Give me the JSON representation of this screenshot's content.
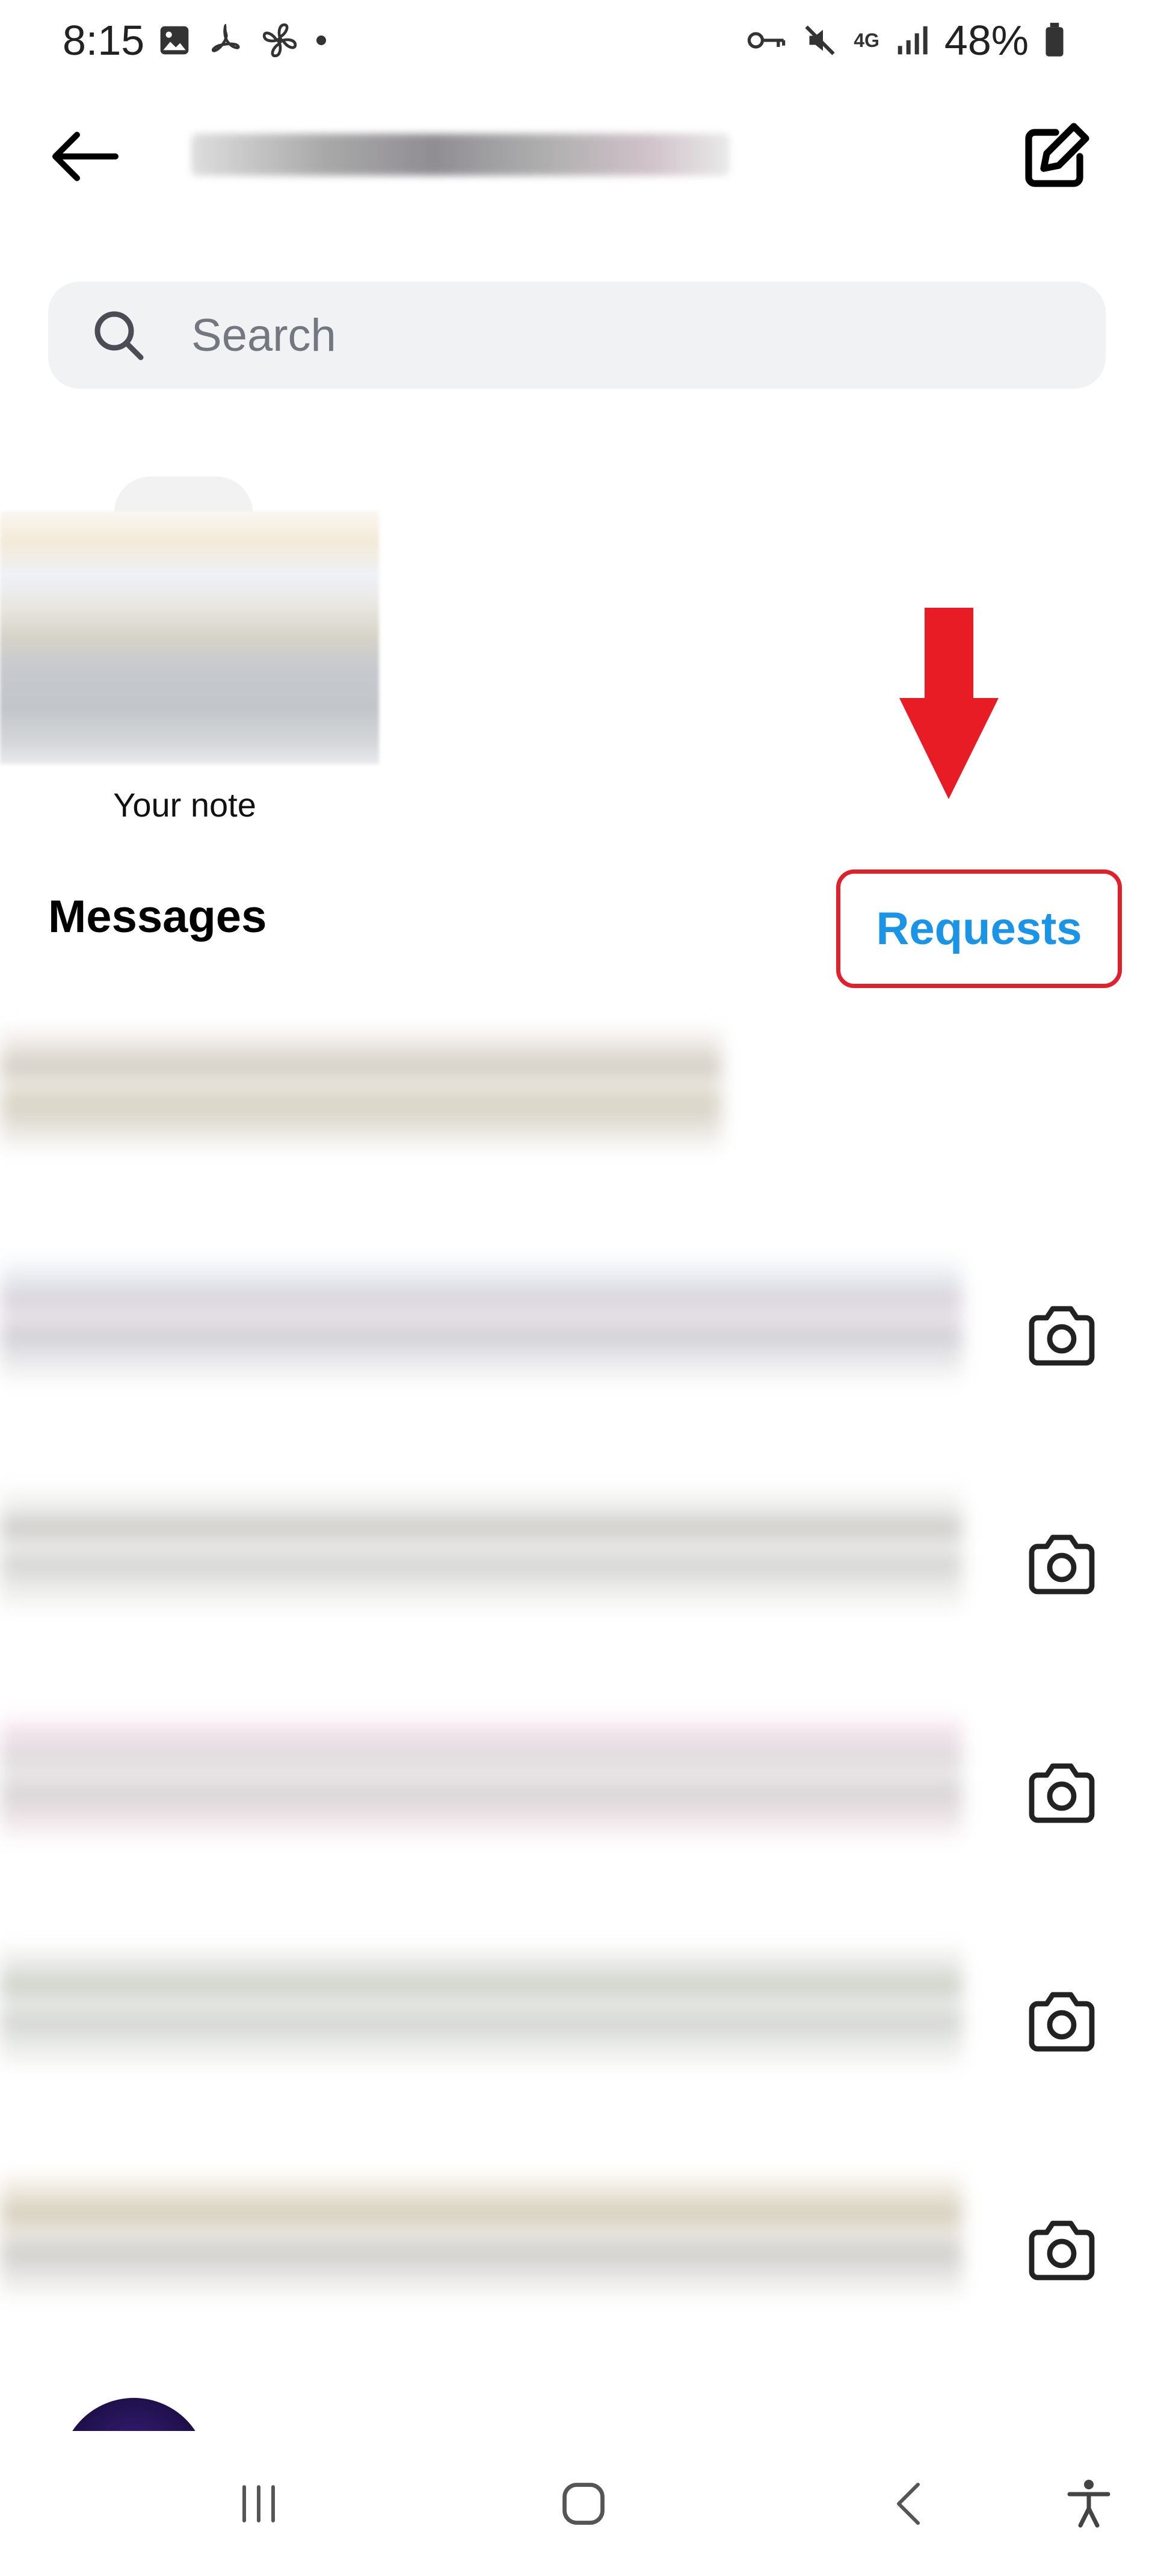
{
  "status_bar": {
    "time": "8:15",
    "network": "4G",
    "battery": "48%"
  },
  "header": {
    "back_icon": "arrow-left-icon",
    "compose_icon": "compose-icon"
  },
  "search": {
    "placeholder": "Search",
    "value": ""
  },
  "notes": {
    "your_note_label": "Your note"
  },
  "messages": {
    "title": "Messages",
    "requests_label": "Requests",
    "highlight_color": "#e0202b",
    "arrow_color": "#e81c24",
    "requests_color": "#1a94e6"
  },
  "conversations": [
    {
      "camera_icon": false
    },
    {
      "camera_icon": true
    },
    {
      "camera_icon": true
    },
    {
      "camera_icon": true
    },
    {
      "camera_icon": true
    },
    {
      "camera_icon": true
    }
  ],
  "nav_bar": {
    "items": [
      "recents-icon",
      "home-icon",
      "back-icon",
      "accessibility-icon"
    ]
  }
}
